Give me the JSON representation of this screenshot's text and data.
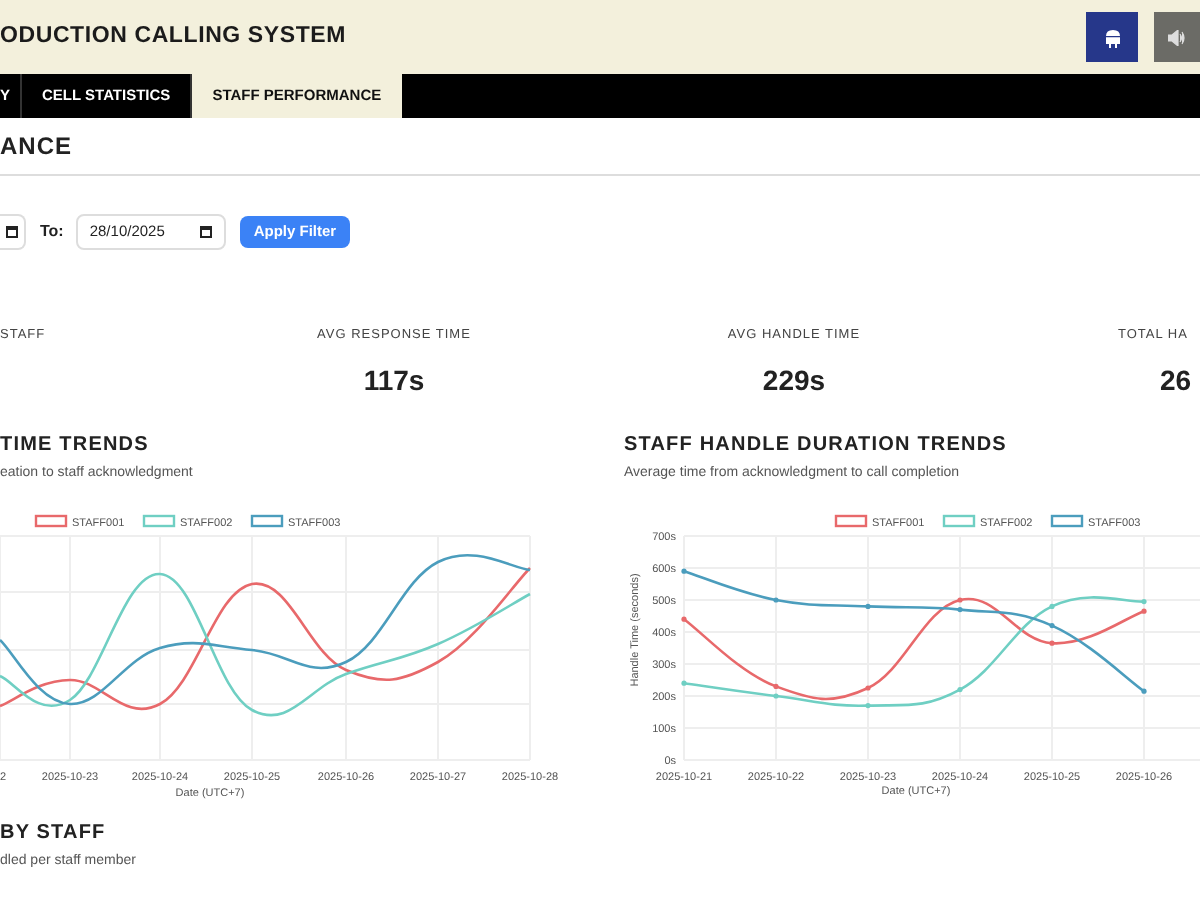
{
  "header": {
    "title": "ODUCTION CALLING SYSTEM"
  },
  "tabs": [
    {
      "label": "Y",
      "selected": false
    },
    {
      "label": "CELL STATISTICS",
      "selected": false
    },
    {
      "label": "STAFF PERFORMANCE",
      "selected": true
    }
  ],
  "page_heading": "ANCE",
  "filter": {
    "to_label": "To:",
    "to_value": "28/10/2025",
    "button": "Apply Filter"
  },
  "stats": [
    {
      "label": "STAFF"
    },
    {
      "label": "AVG RESPONSE TIME",
      "value": "117s"
    },
    {
      "label": "AVG HANDLE TIME",
      "value": "229s"
    },
    {
      "label": "TOTAL HA",
      "value": "26"
    }
  ],
  "response_chart": {
    "title": "TIME TRENDS",
    "subtitle": "eation to staff acknowledgment",
    "kind": "picture",
    "legend": [
      {
        "label": "STAFF001",
        "color": "#e8696b"
      },
      {
        "label": "STAFF002",
        "color": "#6fcfc3"
      },
      {
        "label": "STAFF003",
        "color": "#4b9dbd"
      }
    ],
    "xticks": [
      "2",
      "2025-10-23",
      "2025-10-24",
      "2025-10-25",
      "2025-10-26",
      "2025-10-27",
      "2025-10-28"
    ],
    "xlabel": "Date (UTC+7)"
  },
  "handle_chart": {
    "title": "STAFF HANDLE DURATION TRENDS",
    "subtitle": "Average time from acknowledgment to call completion",
    "chart_data": {
      "type": "line",
      "xlabel": "Date (UTC+7)",
      "ylabel": "Handle Time (seconds)",
      "categories": [
        "2025-10-21",
        "2025-10-22",
        "2025-10-23",
        "2025-10-24",
        "2025-10-25",
        "2025-10-26"
      ],
      "series": [
        {
          "name": "STAFF001",
          "color": "#e8696b",
          "values": [
            440,
            230,
            225,
            500,
            365,
            465
          ]
        },
        {
          "name": "STAFF002",
          "color": "#6fcfc3",
          "values": [
            240,
            200,
            170,
            220,
            480,
            495
          ]
        },
        {
          "name": "STAFF003",
          "color": "#4b9dbd",
          "values": [
            590,
            500,
            480,
            470,
            420,
            215
          ]
        }
      ],
      "ylim": [
        0,
        700
      ],
      "grid": true,
      "legend": true,
      "yticks": [
        {
          "value": 0,
          "label": "0s"
        },
        {
          "value": 100,
          "label": "100s"
        },
        {
          "value": 200,
          "label": "200s"
        },
        {
          "value": 300,
          "label": "300s"
        },
        {
          "value": 400,
          "label": "400s"
        },
        {
          "value": 500,
          "label": "500s"
        },
        {
          "value": 600,
          "label": "600s"
        },
        {
          "value": 700,
          "label": "700s"
        }
      ]
    }
  },
  "by_staff": {
    "title": "BY STAFF",
    "subtitle": "dled per staff member"
  }
}
